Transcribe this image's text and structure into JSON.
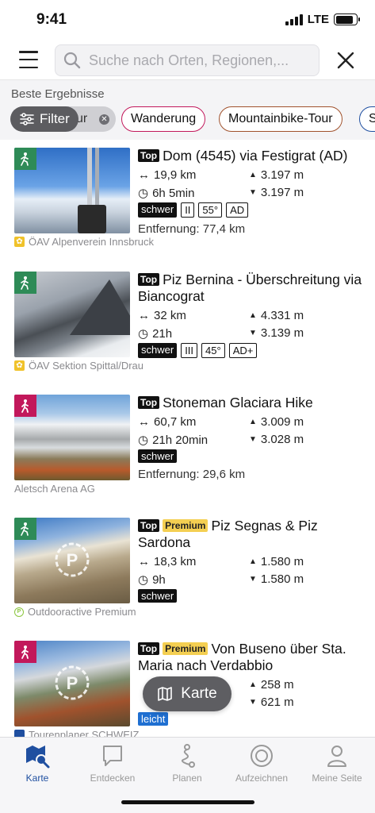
{
  "status_bar": {
    "time": "9:41",
    "network": "LTE",
    "battery_level": 0.85
  },
  "search": {
    "placeholder": "Suche nach Orten, Regionen,..."
  },
  "results": {
    "label": "Beste Ergebnisse"
  },
  "chips": {
    "filter": "Filter",
    "active_partial": "ur",
    "items": [
      {
        "label": "Wanderung",
        "color": "#c2185b"
      },
      {
        "label": "Mountainbike-Tour",
        "color": "#a0522d"
      },
      {
        "label": "S",
        "color": "#1f4fa0"
      }
    ]
  },
  "tours": [
    {
      "category": "bergtour-icon",
      "category_color": "#2e8b57",
      "tags": [
        "Top"
      ],
      "title": "Dom (4545) via Festigrat (AD)",
      "length": "19,9 km",
      "ascent": "3.197 m",
      "duration": "6h 5min",
      "descent": "3.197 m",
      "difficulty": "schwer",
      "grades": [
        "II",
        "55°",
        "AD"
      ],
      "distance": "Entfernung: 77,4 km",
      "source": "ÖAV Alpenverein Innsbruck",
      "source_icon": "edelweiss-icon"
    },
    {
      "category": "bergtour-icon",
      "category_color": "#2e8b57",
      "tags": [
        "Top"
      ],
      "title": "Piz Bernina - Überschreitung via Biancograt",
      "length": "32 km",
      "ascent": "4.331 m",
      "duration": "21h",
      "descent": "3.139 m",
      "difficulty": "schwer",
      "grades": [
        "III",
        "45°",
        "AD+"
      ],
      "distance": "",
      "source": "ÖAV Sektion Spittal/Drau",
      "source_icon": "edelweiss-icon"
    },
    {
      "category": "hiking-icon",
      "category_color": "#c2185b",
      "tags": [
        "Top"
      ],
      "title": "Stoneman Glaciara Hike",
      "length": "60,7 km",
      "ascent": "3.009 m",
      "duration": "21h 20min",
      "descent": "3.028 m",
      "difficulty": "schwer",
      "grades": [],
      "distance": "Entfernung: 29,6 km",
      "source": "Aletsch Arena AG",
      "source_icon": ""
    },
    {
      "category": "bergtour-icon",
      "category_color": "#2e8b57",
      "tags": [
        "Top",
        "Premium"
      ],
      "title": "Piz Segnas & Piz Sardona",
      "length": "18,3 km",
      "ascent": "1.580 m",
      "duration": "9h",
      "descent": "1.580 m",
      "difficulty": "schwer",
      "grades": [],
      "distance": "",
      "source": "Outdooractive Premium",
      "source_icon": "premium-icon"
    },
    {
      "category": "hiking-icon",
      "category_color": "#c2185b",
      "tags": [
        "Top",
        "Premium"
      ],
      "title": "Von Buseno über Sta. Maria nach Verdabbio",
      "length": "",
      "ascent": "258 m",
      "duration": "",
      "descent": "621 m",
      "difficulty": "leicht",
      "grades": [],
      "distance": "",
      "source": "Tourenplaner SCHWEIZ",
      "source_icon": "flag-icon"
    }
  ],
  "map_button": {
    "label": "Karte"
  },
  "tabbar": {
    "items": [
      {
        "label": "Karte",
        "icon": "map-search-icon",
        "active": true
      },
      {
        "label": "Entdecken",
        "icon": "speech-bubble-icon",
        "active": false
      },
      {
        "label": "Planen",
        "icon": "route-icon",
        "active": false
      },
      {
        "label": "Aufzeichnen",
        "icon": "record-icon",
        "active": false
      },
      {
        "label": "Meine Seite",
        "icon": "person-icon",
        "active": false
      }
    ]
  }
}
